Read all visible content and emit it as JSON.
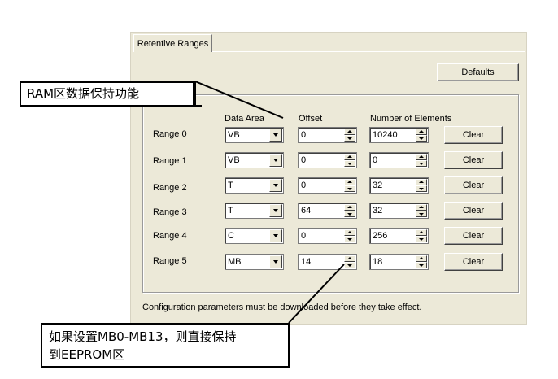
{
  "tab": {
    "label": "Retentive Ranges"
  },
  "defaults_button": "Defaults",
  "headers": {
    "data_area": "Data Area",
    "offset": "Offset",
    "count": "Number of Elements"
  },
  "rows": [
    {
      "label": "Range 0",
      "area": "VB",
      "offset": "0",
      "count": "10240",
      "clear": "Clear"
    },
    {
      "label": "Range 1",
      "area": "VB",
      "offset": "0",
      "count": "0",
      "clear": "Clear"
    },
    {
      "label": "Range 2",
      "area": "T",
      "offset": "0",
      "count": "32",
      "clear": "Clear"
    },
    {
      "label": "Range 3",
      "area": "T",
      "offset": "64",
      "count": "32",
      "clear": "Clear"
    },
    {
      "label": "Range 4",
      "area": "C",
      "offset": "0",
      "count": "256",
      "clear": "Clear"
    },
    {
      "label": "Range 5",
      "area": "MB",
      "offset": "14",
      "count": "18",
      "clear": "Clear"
    }
  ],
  "footer": "Configuration parameters must be downloaded before they take effect.",
  "callouts": {
    "ram": "RAM区数据保持功能",
    "eeprom_line1": "如果设置MB0-MB13，则直接保持",
    "eeprom_line2": "到EEPROM区"
  }
}
